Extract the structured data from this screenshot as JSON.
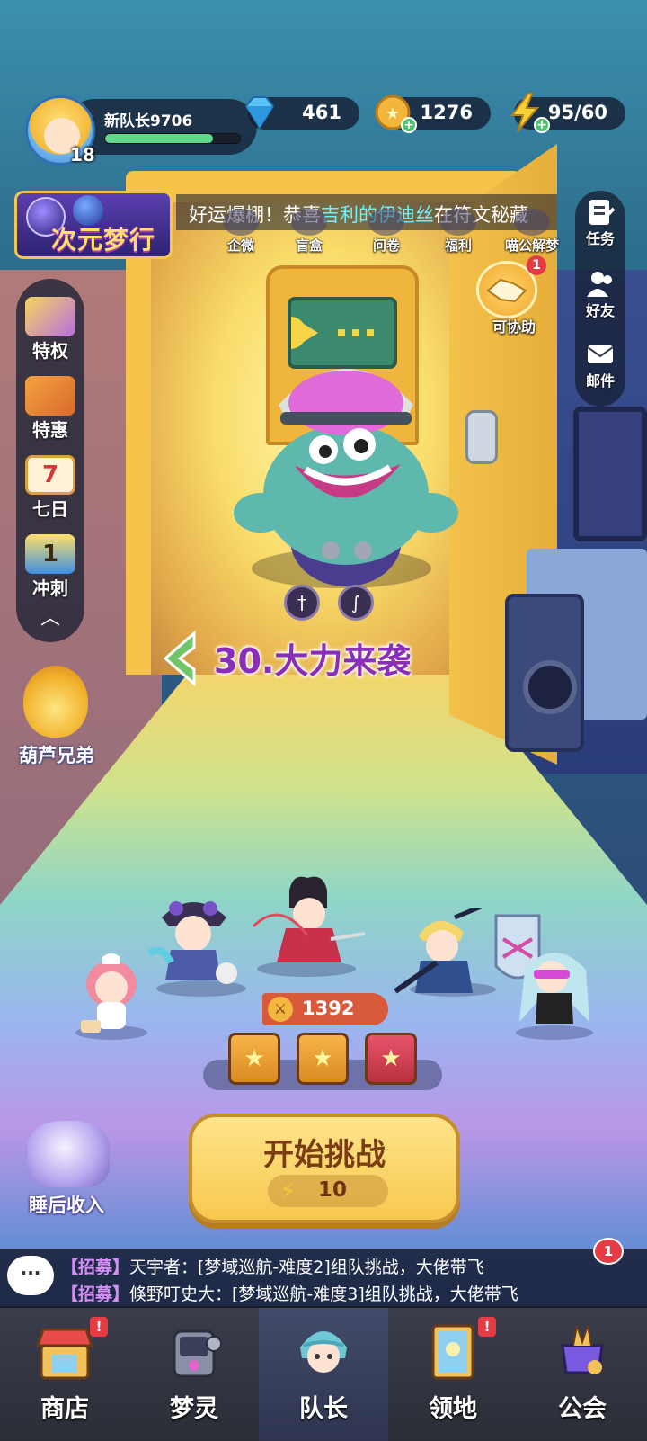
{
  "player": {
    "name": "新队长9706",
    "level": "18",
    "xp_fraction": 0.8
  },
  "resources": {
    "diamonds": "461",
    "coins": "1276",
    "energy": "95/60"
  },
  "event_banner": {
    "label": "次元梦行"
  },
  "marquee": {
    "prefix": "好运爆棚！恭喜",
    "highlight": "吉利的伊迪丝",
    "suffix": "在符文秘藏"
  },
  "mini_icons": [
    {
      "label": "企微",
      "icon": "wecom-icon"
    },
    {
      "label": "盲盒",
      "icon": "blind-box-icon"
    },
    {
      "label": "问卷",
      "icon": "survey-icon"
    },
    {
      "label": "福利",
      "icon": "welfare-icon"
    },
    {
      "label": "喵公解梦",
      "icon": "cat-dream-icon"
    }
  ],
  "right_panel": [
    {
      "label": "任务",
      "icon": "task-icon"
    },
    {
      "label": "好友",
      "icon": "friends-icon"
    },
    {
      "label": "邮件",
      "icon": "mail-icon"
    }
  ],
  "assist": {
    "label": "可协助",
    "badge": "1"
  },
  "left_panel": [
    {
      "label": "特权",
      "icon": "privilege-icon"
    },
    {
      "label": "特惠",
      "icon": "special-offer-icon"
    },
    {
      "label": "七日",
      "icon": "seven-day-icon",
      "badge_digit": "7"
    },
    {
      "label": "冲刺",
      "icon": "sprint-icon",
      "badge_digit": "1"
    }
  ],
  "gourd": {
    "label": "葫芦兄弟"
  },
  "level": {
    "title": "30.大力来袭"
  },
  "team": {
    "power": "1392"
  },
  "start": {
    "label": "开始挑战",
    "cost": "10"
  },
  "sleep": {
    "label": "睡后收入"
  },
  "chat": {
    "badge": "1",
    "lines": [
      {
        "tag": "【招募】",
        "text": "天宇者：[梦域巡航-难度2]组队挑战，大佬带飞"
      },
      {
        "tag": "【招募】",
        "text": "倏野叮史大：[梦域巡航-难度3]组队挑战，大佬带飞"
      }
    ]
  },
  "nav": [
    {
      "label": "商店",
      "icon": "shop-icon",
      "alert": "!"
    },
    {
      "label": "梦灵",
      "icon": "dream-spirit-icon"
    },
    {
      "label": "队长",
      "icon": "captain-icon"
    },
    {
      "label": "领地",
      "icon": "territory-icon",
      "alert": "!"
    },
    {
      "label": "公会",
      "icon": "guild-icon"
    }
  ],
  "colors": {
    "accent_gold": "#f7c84e",
    "level_title": "#8a2db8",
    "alert_red": "#e53b45",
    "marquee_highlight": "#6ff0ff",
    "recruit_tag": "#d58ef5"
  }
}
